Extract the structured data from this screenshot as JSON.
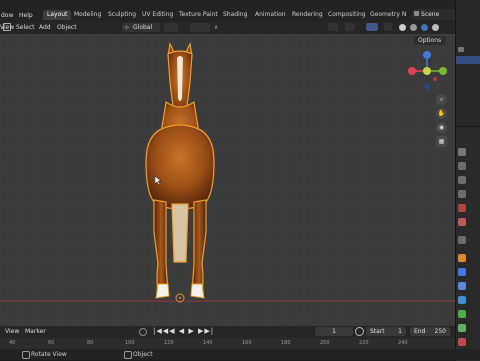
{
  "topbar": {
    "menus": [
      "dow",
      "Help"
    ],
    "workspaces": [
      {
        "label": "Layout",
        "active": true
      },
      {
        "label": "Modeling",
        "active": false
      },
      {
        "label": "Sculpting",
        "active": false
      },
      {
        "label": "UV Editing",
        "active": false
      },
      {
        "label": "Texture Paint",
        "active": false
      },
      {
        "label": "Shading",
        "active": false
      },
      {
        "label": "Animation",
        "active": false
      },
      {
        "label": "Rendering",
        "active": false
      },
      {
        "label": "Compositing",
        "active": false
      },
      {
        "label": "Geometry N",
        "active": false
      }
    ],
    "scene_label": "Scene"
  },
  "viewport_header": {
    "view": "View",
    "select": "Select",
    "add": "Add",
    "object": "Object",
    "orientation": "Global",
    "options": "Options"
  },
  "timeline": {
    "view": "View",
    "marker": "Marker",
    "current_frame": "1",
    "start_label": "Start",
    "start_value": "1",
    "end_label": "End",
    "end_value": "250",
    "ruler": [
      "40",
      "60",
      "80",
      "100",
      "120",
      "140",
      "160",
      "180",
      "200",
      "220",
      "240"
    ]
  },
  "statusbar": {
    "left": "Rotate View",
    "mid": "Object"
  },
  "colors": {
    "accent": "#4772b3",
    "selection": "#f29e2c",
    "axis_x": "#e0425a",
    "axis_y": "#7cb82d",
    "axis_z": "#3d7be0"
  }
}
